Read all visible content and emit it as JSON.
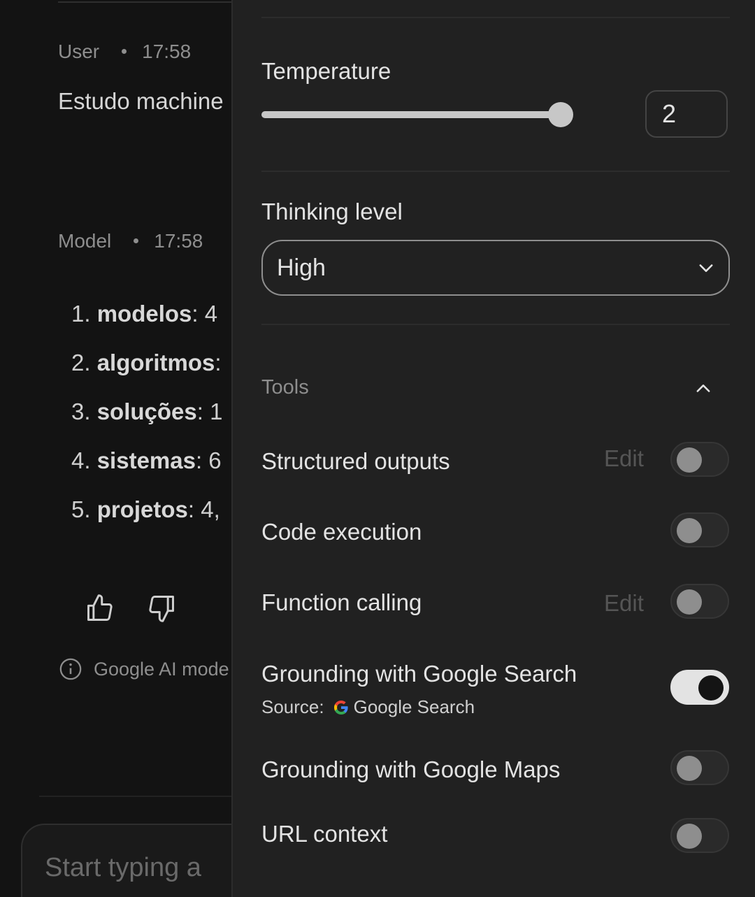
{
  "chat": {
    "user_message": {
      "author": "User",
      "time": "17:58",
      "text": "Estudo machine"
    },
    "model_message": {
      "author": "Model",
      "time": "17:58",
      "items": [
        {
          "num": "1.",
          "term": "modelos",
          "rest": ": 4"
        },
        {
          "num": "2.",
          "term": "algoritmos",
          "rest": ":"
        },
        {
          "num": "3.",
          "term": "soluções",
          "rest": ": 1"
        },
        {
          "num": "4.",
          "term": "sistemas",
          "rest": ": 6"
        },
        {
          "num": "5.",
          "term": "projetos",
          "rest": ": 4,"
        }
      ]
    },
    "feedback": {
      "like_icon": "thumbs-up-icon",
      "dislike_icon": "thumbs-down-icon"
    },
    "disclaimer": "Google AI mode",
    "composer_placeholder": "Start typing a"
  },
  "settings": {
    "temperature": {
      "label": "Temperature",
      "value": "2",
      "min": 0,
      "max": 2
    },
    "thinking_level": {
      "label": "Thinking level",
      "selected": "High"
    },
    "tools": {
      "label": "Tools",
      "expanded": true,
      "items": [
        {
          "label": "Structured outputs",
          "edit": "Edit",
          "enabled": false
        },
        {
          "label": "Code execution",
          "enabled": false
        },
        {
          "label": "Function calling",
          "edit": "Edit",
          "enabled": false
        },
        {
          "label": "Grounding with Google Search",
          "source_prefix": "Source:",
          "source_name": "Google Search",
          "enabled": true
        },
        {
          "label": "Grounding with Google Maps",
          "enabled": false
        },
        {
          "label": "URL context",
          "enabled": false
        }
      ]
    }
  },
  "colors": {
    "panel_bg": "#212121",
    "chat_bg": "#131313",
    "text": "#e3e3e3",
    "muted": "#8e8e8e"
  }
}
